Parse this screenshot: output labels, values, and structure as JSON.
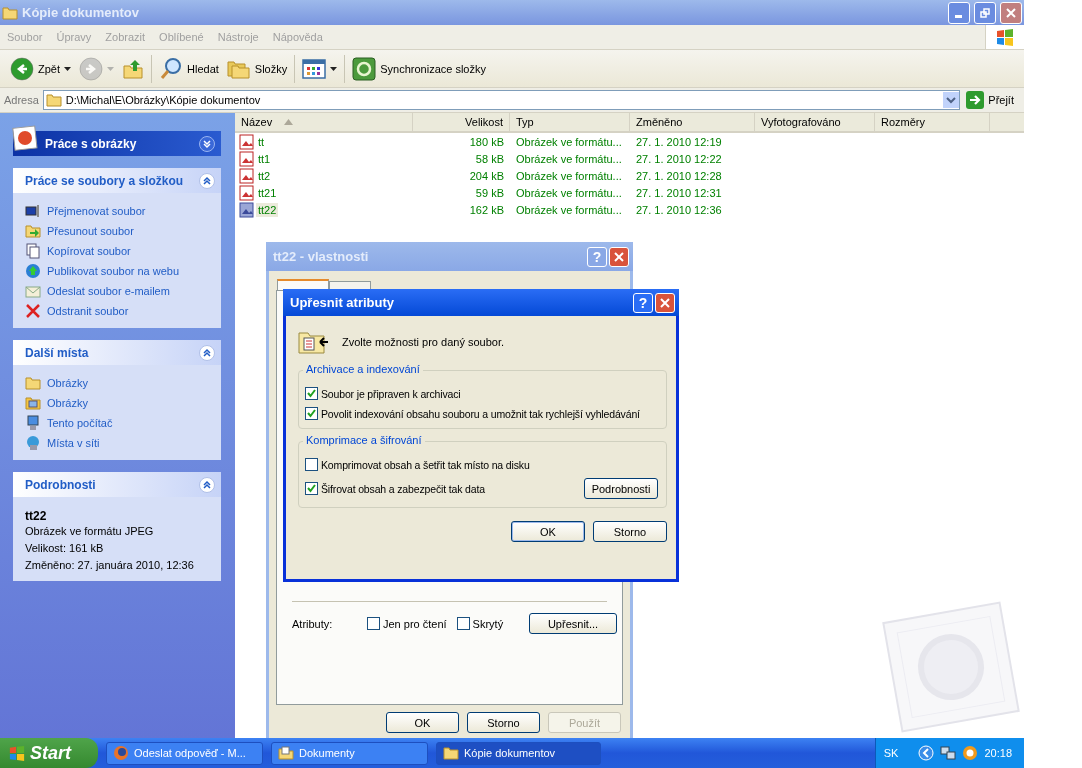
{
  "window": {
    "title": "Kópie dokumentov"
  },
  "menu": [
    "Soubor",
    "Úpravy",
    "Zobrazit",
    "Oblíbené",
    "Nástroje",
    "Nápověda"
  ],
  "toolbar": {
    "buttons": [
      {
        "kind": "back",
        "label": "Zpět",
        "disabled": false
      },
      {
        "kind": "forward",
        "disabled": true
      },
      {
        "kind": "up",
        "disabled": false
      },
      {
        "kind": "search",
        "label": "Hledat",
        "disabled": false
      },
      {
        "kind": "folders",
        "label": "Složky",
        "disabled": false
      },
      {
        "kind": "views",
        "disabled": false
      },
      {
        "kind": "sync",
        "label": "Synchronizace složky",
        "disabled": false
      }
    ]
  },
  "address": {
    "label": "Adresa",
    "value": "D:\\Michal\\E\\Obrázky\\Kópie dokumentov",
    "go": "Přejít"
  },
  "sidebar": {
    "header": {
      "title": "Práce s obrázky",
      "expanded": false
    },
    "sections": [
      {
        "title": "Práce se soubory a složkou",
        "expanded": true,
        "items": [
          {
            "kind": "rename",
            "label": "Přejmenovat soubor"
          },
          {
            "kind": "move",
            "label": "Přesunout soubor"
          },
          {
            "kind": "copy",
            "label": "Kopírovat soubor"
          },
          {
            "kind": "publish",
            "label": "Publikovat soubor na webu"
          },
          {
            "kind": "email",
            "label": "Odeslat soubor e-mailem"
          },
          {
            "kind": "delete",
            "label": "Odstranit soubor"
          }
        ]
      },
      {
        "title": "Další místa",
        "expanded": true,
        "items": [
          {
            "kind": "folder",
            "label": "Obrázky"
          },
          {
            "kind": "pictures",
            "label": "Obrázky"
          },
          {
            "kind": "computer",
            "label": "Tento počítač"
          },
          {
            "kind": "network",
            "label": "Místa v síti"
          }
        ]
      }
    ],
    "details": {
      "title": "Podrobnosti",
      "expanded": true,
      "name": "tt22",
      "lines": [
        "Obrázek ve formátu JPEG",
        "Velikost: 161 kB",
        "Změněno: 27. januára 2010, 12:36"
      ]
    }
  },
  "file_list": {
    "columns": [
      {
        "label": "Název",
        "sorted": true
      },
      {
        "label": "Velikost",
        "sorted": false
      },
      {
        "label": "Typ",
        "sorted": false
      },
      {
        "label": "Změněno",
        "sorted": false
      },
      {
        "label": "Vyfotografováno",
        "sorted": false
      },
      {
        "label": "Rozměry",
        "sorted": false
      }
    ],
    "rows": [
      {
        "name": "tt",
        "size": "180 kB",
        "type": "Obrázek ve formátu...",
        "modified": "27. 1. 2010 12:19",
        "selected": false
      },
      {
        "name": "tt1",
        "size": "58 kB",
        "type": "Obrázek ve formátu...",
        "modified": "27. 1. 2010 12:22",
        "selected": false
      },
      {
        "name": "tt2",
        "size": "204 kB",
        "type": "Obrázek ve formátu...",
        "modified": "27. 1. 2010 12:28",
        "selected": false
      },
      {
        "name": "tt21",
        "size": "59 kB",
        "type": "Obrázek ve formátu...",
        "modified": "27. 1. 2010 12:31",
        "selected": false
      },
      {
        "name": "tt22",
        "size": "162 kB",
        "type": "Obrázek ve formátu...",
        "modified": "27. 1. 2010 12:36",
        "selected": true
      }
    ]
  },
  "properties_dialog": {
    "title": "tt22 - vlastnosti",
    "help": "?",
    "attributes_label": "Atributy:",
    "checkboxes": [
      {
        "label": "Jen pro čtení",
        "checked": false
      },
      {
        "label": "Skrytý",
        "checked": false
      }
    ],
    "advanced_button": "Upřesnit...",
    "buttons": [
      {
        "label": "OK",
        "disabled": false
      },
      {
        "label": "Storno",
        "disabled": false
      },
      {
        "label": "Použít",
        "disabled": true
      }
    ]
  },
  "attributes_dialog": {
    "title": "Upřesnit atributy",
    "help": "?",
    "prompt": "Zvolte možnosti pro daný soubor.",
    "groups": [
      {
        "title": "Archivace a indexování",
        "options": [
          {
            "label": "Soubor je připraven k archivaci",
            "checked": true
          },
          {
            "label": "Povolit indexování obsahu souboru a umožnit tak rychlejší vyhledávání",
            "checked": true
          }
        ]
      },
      {
        "title": "Komprimace a šifrování",
        "options": [
          {
            "label": "Komprimovat obsah a šetřit tak místo na disku",
            "checked": false
          },
          {
            "label": "Šifrovat obsah a zabezpečit tak data",
            "checked": true,
            "button": "Podrobnosti"
          }
        ]
      }
    ],
    "buttons": [
      {
        "label": "OK",
        "default": true
      },
      {
        "label": "Storno",
        "default": false
      }
    ]
  },
  "taskbar": {
    "start": "Start",
    "tasks": [
      {
        "kind": "browser",
        "label": "Odeslat odpověď - M...",
        "selected": false
      },
      {
        "kind": "documents",
        "label": "Dokumenty",
        "selected": false
      },
      {
        "kind": "folder",
        "label": "Kópie dokumentov",
        "selected": true
      }
    ],
    "language": "SK",
    "clock": "20:18"
  }
}
